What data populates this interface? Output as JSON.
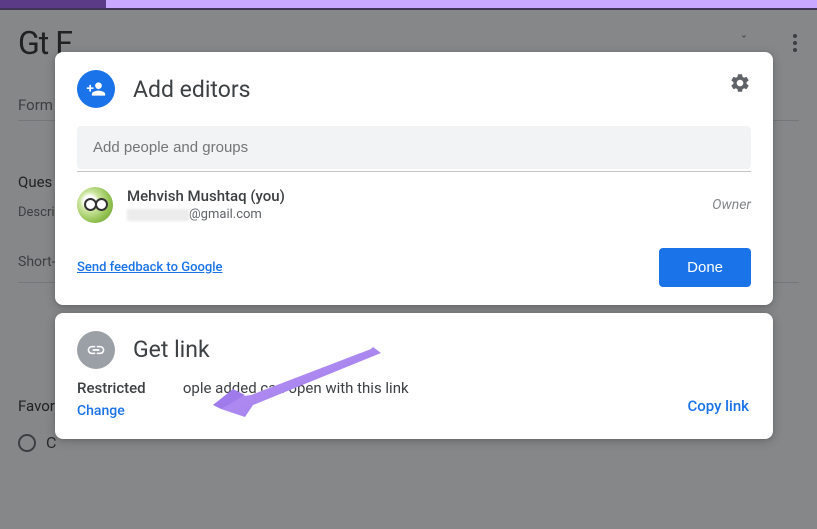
{
  "background": {
    "title_fragment": "Gt F",
    "subtitle_fragment": "Form c",
    "section1": "Ques",
    "section1_desc": "Descrip",
    "section1_short": "Short-a",
    "section2": "Favor",
    "section2_option": "C"
  },
  "dialog": {
    "editors": {
      "title": "Add editors",
      "input_placeholder": "Add people and groups",
      "person": {
        "name": "Mehvish Mushtaq (you)",
        "email_suffix": "@gmail.com",
        "role": "Owner"
      },
      "feedback": "Send feedback to Google",
      "done": "Done"
    },
    "link": {
      "title": "Get link",
      "restricted_label": "Restricted",
      "restricted_text_partial": "ople added can open with this link",
      "change": "Change",
      "copy": "Copy link"
    }
  }
}
